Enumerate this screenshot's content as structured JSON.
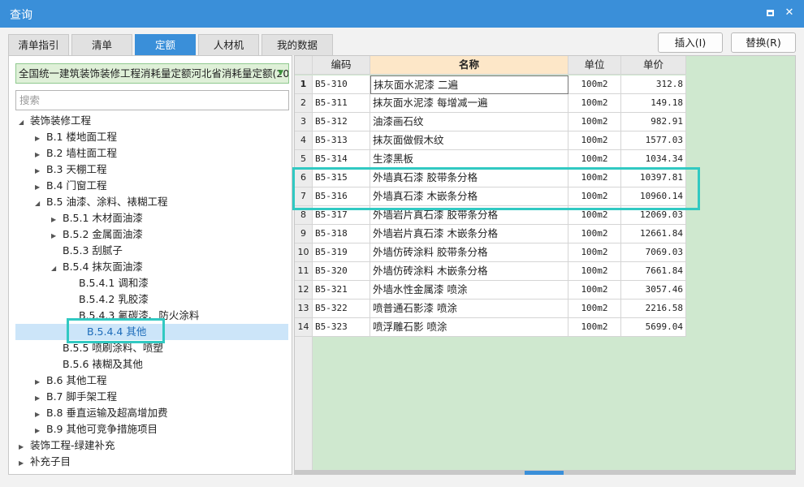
{
  "window": {
    "title": "查询",
    "maximize_label": "",
    "close_label": "✕"
  },
  "tabs": [
    {
      "label": "清单指引",
      "active": false
    },
    {
      "label": "清单",
      "active": false
    },
    {
      "label": "定额",
      "active": true
    },
    {
      "label": "人材机",
      "active": false
    },
    {
      "label": "我的数据",
      "active": false
    }
  ],
  "actions": {
    "insert_label": "插入(I)",
    "replace_label": "替换(R)"
  },
  "library": {
    "selected": "全国统一建筑装饰装修工程消耗量定额河北省消耗量定额(20",
    "arrow": "▼"
  },
  "search": {
    "placeholder": "搜索"
  },
  "tree": [
    {
      "label": "装饰装修工程",
      "level": 0,
      "toggle": "◢"
    },
    {
      "label": "B.1 楼地面工程",
      "level": 1,
      "toggle": "▶"
    },
    {
      "label": "B.2 墙柱面工程",
      "level": 1,
      "toggle": "▶"
    },
    {
      "label": "B.3 天棚工程",
      "level": 1,
      "toggle": "▶"
    },
    {
      "label": "B.4 门窗工程",
      "level": 1,
      "toggle": "▶"
    },
    {
      "label": "B.5 油漆、涂料、裱糊工程",
      "level": 1,
      "toggle": "◢"
    },
    {
      "label": "B.5.1 木材面油漆",
      "level": 2,
      "toggle": "▶"
    },
    {
      "label": "B.5.2 金属面油漆",
      "level": 2,
      "toggle": "▶"
    },
    {
      "label": "B.5.3 刮腻子",
      "level": 2,
      "toggle": ""
    },
    {
      "label": "B.5.4 抹灰面油漆",
      "level": 2,
      "toggle": "◢"
    },
    {
      "label": "B.5.4.1 调和漆",
      "level": 3,
      "toggle": ""
    },
    {
      "label": "B.5.4.2 乳胶漆",
      "level": 3,
      "toggle": ""
    },
    {
      "label": "B.5.4.3 氟碳漆、防火涂料",
      "level": 3,
      "toggle": ""
    },
    {
      "label": "B.5.4.4 其他",
      "level": 3,
      "toggle": "",
      "selected": true
    },
    {
      "label": "B.5.5 喷刷涂料、喷塑",
      "level": 2,
      "toggle": ""
    },
    {
      "label": "B.5.6 裱糊及其他",
      "level": 2,
      "toggle": ""
    },
    {
      "label": "B.6 其他工程",
      "level": 1,
      "toggle": "▶"
    },
    {
      "label": "B.7 脚手架工程",
      "level": 1,
      "toggle": "▶"
    },
    {
      "label": "B.8 垂直运输及超高增加费",
      "level": 1,
      "toggle": "▶"
    },
    {
      "label": "B.9 其他可竞争措施项目",
      "level": 1,
      "toggle": "▶"
    },
    {
      "label": "装饰工程-绿建补充",
      "level": 0,
      "toggle": "▶"
    },
    {
      "label": "补充子目",
      "level": 0,
      "toggle": "▶"
    }
  ],
  "table": {
    "headers": {
      "code": "编码",
      "name": "名称",
      "unit": "单位",
      "price": "单价"
    },
    "rows": [
      {
        "idx": "1",
        "code": "B5-310",
        "name": "抹灰面水泥漆 二遍",
        "unit": "100m2",
        "price": "312.8"
      },
      {
        "idx": "2",
        "code": "B5-311",
        "name": "抹灰面水泥漆 每增减一遍",
        "unit": "100m2",
        "price": "149.18"
      },
      {
        "idx": "3",
        "code": "B5-312",
        "name": "油漆画石纹",
        "unit": "100m2",
        "price": "982.91"
      },
      {
        "idx": "4",
        "code": "B5-313",
        "name": "抹灰面做假木纹",
        "unit": "100m2",
        "price": "1577.03"
      },
      {
        "idx": "5",
        "code": "B5-314",
        "name": "生漆黑板",
        "unit": "100m2",
        "price": "1034.34"
      },
      {
        "idx": "6",
        "code": "B5-315",
        "name": "外墙真石漆 胶带条分格",
        "unit": "100m2",
        "price": "10397.81"
      },
      {
        "idx": "7",
        "code": "B5-316",
        "name": "外墙真石漆 木嵌条分格",
        "unit": "100m2",
        "price": "10960.14"
      },
      {
        "idx": "8",
        "code": "B5-317",
        "name": "外墙岩片真石漆 胶带条分格",
        "unit": "100m2",
        "price": "12069.03"
      },
      {
        "idx": "9",
        "code": "B5-318",
        "name": "外墙岩片真石漆 木嵌条分格",
        "unit": "100m2",
        "price": "12661.84"
      },
      {
        "idx": "10",
        "code": "B5-319",
        "name": "外墙仿砖涂料 胶带条分格",
        "unit": "100m2",
        "price": "7069.03"
      },
      {
        "idx": "11",
        "code": "B5-320",
        "name": "外墙仿砖涂料 木嵌条分格",
        "unit": "100m2",
        "price": "7661.84"
      },
      {
        "idx": "12",
        "code": "B5-321",
        "name": "外墙水性金属漆 喷涂",
        "unit": "100m2",
        "price": "3057.46"
      },
      {
        "idx": "13",
        "code": "B5-322",
        "name": "喷普通石影漆 喷涂",
        "unit": "100m2",
        "price": "2216.58"
      },
      {
        "idx": "14",
        "code": "B5-323",
        "name": "喷浮雕石影 喷涂",
        "unit": "100m2",
        "price": "5699.04"
      }
    ]
  },
  "colors": {
    "accent": "#3a8fd9",
    "highlight": "#31c9c2",
    "grid_bg": "#cfe8cf",
    "name_header": "#fde7c8"
  }
}
